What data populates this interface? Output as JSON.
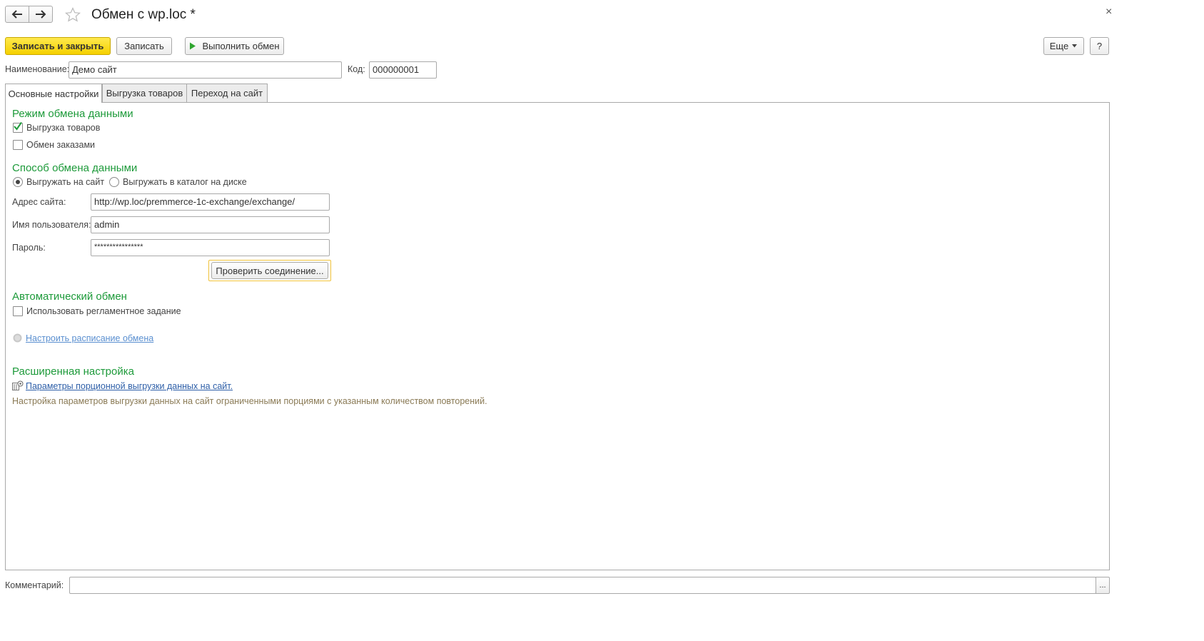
{
  "window": {
    "title": "Обмен с wp.loc *",
    "close_glyph": "×"
  },
  "icons": {
    "back": "arrow-left-icon",
    "forward": "arrow-right-icon",
    "favorite": "star-icon",
    "run": "play-icon",
    "checkmark": "check-icon",
    "schedule": "clock-icon",
    "settings": "gear-icon"
  },
  "toolbar": {
    "save_close": "Записать и закрыть",
    "save": "Записать",
    "run_exchange": "Выполнить обмен",
    "more": "Еще",
    "help": "?"
  },
  "header_fields": {
    "name_label": "Наименование:",
    "name_value": "Демо сайт",
    "code_label": "Код:",
    "code_value": "000000001"
  },
  "tabs": [
    {
      "label": "Основные настройки",
      "active": true
    },
    {
      "label": "Выгрузка товаров",
      "active": false
    },
    {
      "label": "Переход на сайт",
      "active": false
    }
  ],
  "mode_section": {
    "title": "Режим обмена данными",
    "export_goods": {
      "label": "Выгрузка товаров",
      "checked": true
    },
    "exchange_orders": {
      "label": "Обмен заказами",
      "checked": false
    }
  },
  "method_section": {
    "title": "Способ обмена данными",
    "to_site": {
      "label": "Выгружать на сайт",
      "selected": true
    },
    "to_disk": {
      "label": "Выгружать в каталог на диске",
      "selected": false
    },
    "site_address_label": "Адрес сайта:",
    "site_address_value": "http://wp.loc/premmerce-1c-exchange/exchange/",
    "username_label": "Имя пользователя:",
    "username_value": "admin",
    "password_label": "Пароль:",
    "password_value": "****************",
    "check_connection": "Проверить соединение..."
  },
  "auto_section": {
    "title": "Автоматический обмен",
    "use_scheduled_job": {
      "label": "Использовать регламентное задание",
      "checked": false
    },
    "schedule_link": "Настроить расписание обмена"
  },
  "advanced_section": {
    "title": "Расширенная настройка",
    "batch_link": "Параметры порционной выгрузки данных на сайт.",
    "description": "Настройка параметров выгрузки данных на сайт ограниченными порциями с указанным количеством повторений."
  },
  "comment": {
    "label": "Комментарий:",
    "value": "",
    "select_button": "..."
  },
  "colors": {
    "accent_green": "#1d9a3a",
    "primary_yellow": "#f5d000",
    "link_blue": "#3b6fb6"
  }
}
